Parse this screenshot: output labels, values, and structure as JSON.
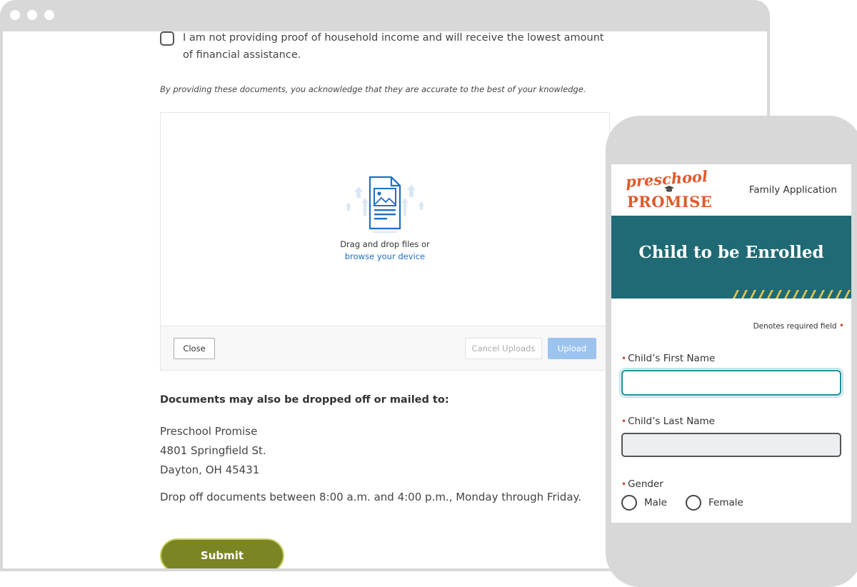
{
  "desktop": {
    "income_checkbox_label": "I am not providing proof of household income and will receive the lowest amount of financial assistance.",
    "acknowledgement": "By providing these documents, you acknowledge that they are accurate to the best of your knowledge.",
    "dropzone": {
      "drag_text": "Drag and drop files or",
      "browse_link": "browse your device",
      "close_label": "Close",
      "cancel_label": "Cancel Uploads",
      "upload_label": "Upload"
    },
    "mail_heading": "Documents may also be dropped off or mailed to:",
    "address": [
      "Preschool Promise",
      "4801 Springfield St.",
      "Dayton, OH 45431"
    ],
    "hours": "Drop off documents between 8:00 a.m. and 4:00 p.m., Monday through Friday.",
    "submit_label": "Submit"
  },
  "mobile": {
    "logo_top": "preschool",
    "logo_bottom": "PROMISE",
    "header_title": "Family Application",
    "banner_title": "Child to be Enrolled",
    "required_note": "Denotes required field",
    "first_name_label": "Child’s First Name",
    "last_name_label": "Child’s Last Name",
    "gender_label": "Gender",
    "gender_options": [
      "Male",
      "Female"
    ]
  },
  "colors": {
    "brand_orange": "#e05a2b",
    "banner_teal": "#1f6a74",
    "submit_olive": "#7b8524",
    "link_blue": "#1f6fc5",
    "required_red": "#d0472c"
  }
}
